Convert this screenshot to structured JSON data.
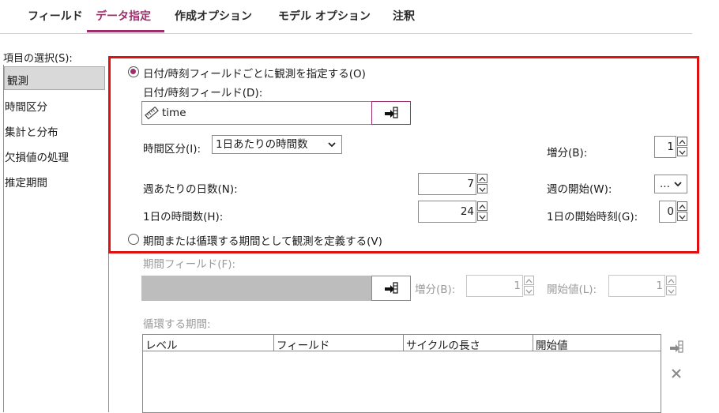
{
  "tabs": [
    {
      "label": "フィールド"
    },
    {
      "label": "データ指定"
    },
    {
      "label": "作成オプション"
    },
    {
      "label": "モデル オプション"
    },
    {
      "label": "注釈"
    }
  ],
  "left_panel": {
    "title": "項目の選択(S):",
    "items": [
      "観測",
      "時間区分",
      "集計と分布",
      "欠損値の処理",
      "推定期間"
    ],
    "selected": "観測"
  },
  "by_datetime": {
    "radio_label": "日付/時刻フィールドごとに観測を指定する(O)",
    "field_label": "日付/時刻フィールド(D):",
    "field_value": "time",
    "interval_label": "時間区分(I):",
    "interval_value": "1日あたりの時間数",
    "increment_label": "増分(B):",
    "increment_value": "1",
    "days_per_week_label": "週あたりの日数(N):",
    "days_per_week_value": "7",
    "week_start_label": "週の開始(W):",
    "week_start_value": "...",
    "hours_per_day_label": "1日の時間数(H):",
    "hours_per_day_value": "24",
    "day_start_label": "1日の開始時刻(G):",
    "day_start_value": "0"
  },
  "by_period": {
    "radio_label": "期間または循環する期間として観測を定義する(V)",
    "period_field_label": "期間フィールド(F):",
    "increment_label": "増分(B):",
    "increment_value": "1",
    "start_label": "開始値(L):",
    "start_value": "1",
    "cyclic_label": "循環する期間:",
    "columns": [
      "レベル",
      "フィールド",
      "サイクルの長さ",
      "開始値"
    ]
  },
  "colors": {
    "accent": "#9c2f6b",
    "highlight": "#e01010"
  },
  "icons": [
    "ruler-icon",
    "field-picker-icon",
    "chevron-down-icon",
    "spin-up-icon",
    "spin-down-icon",
    "delete-x-icon"
  ]
}
